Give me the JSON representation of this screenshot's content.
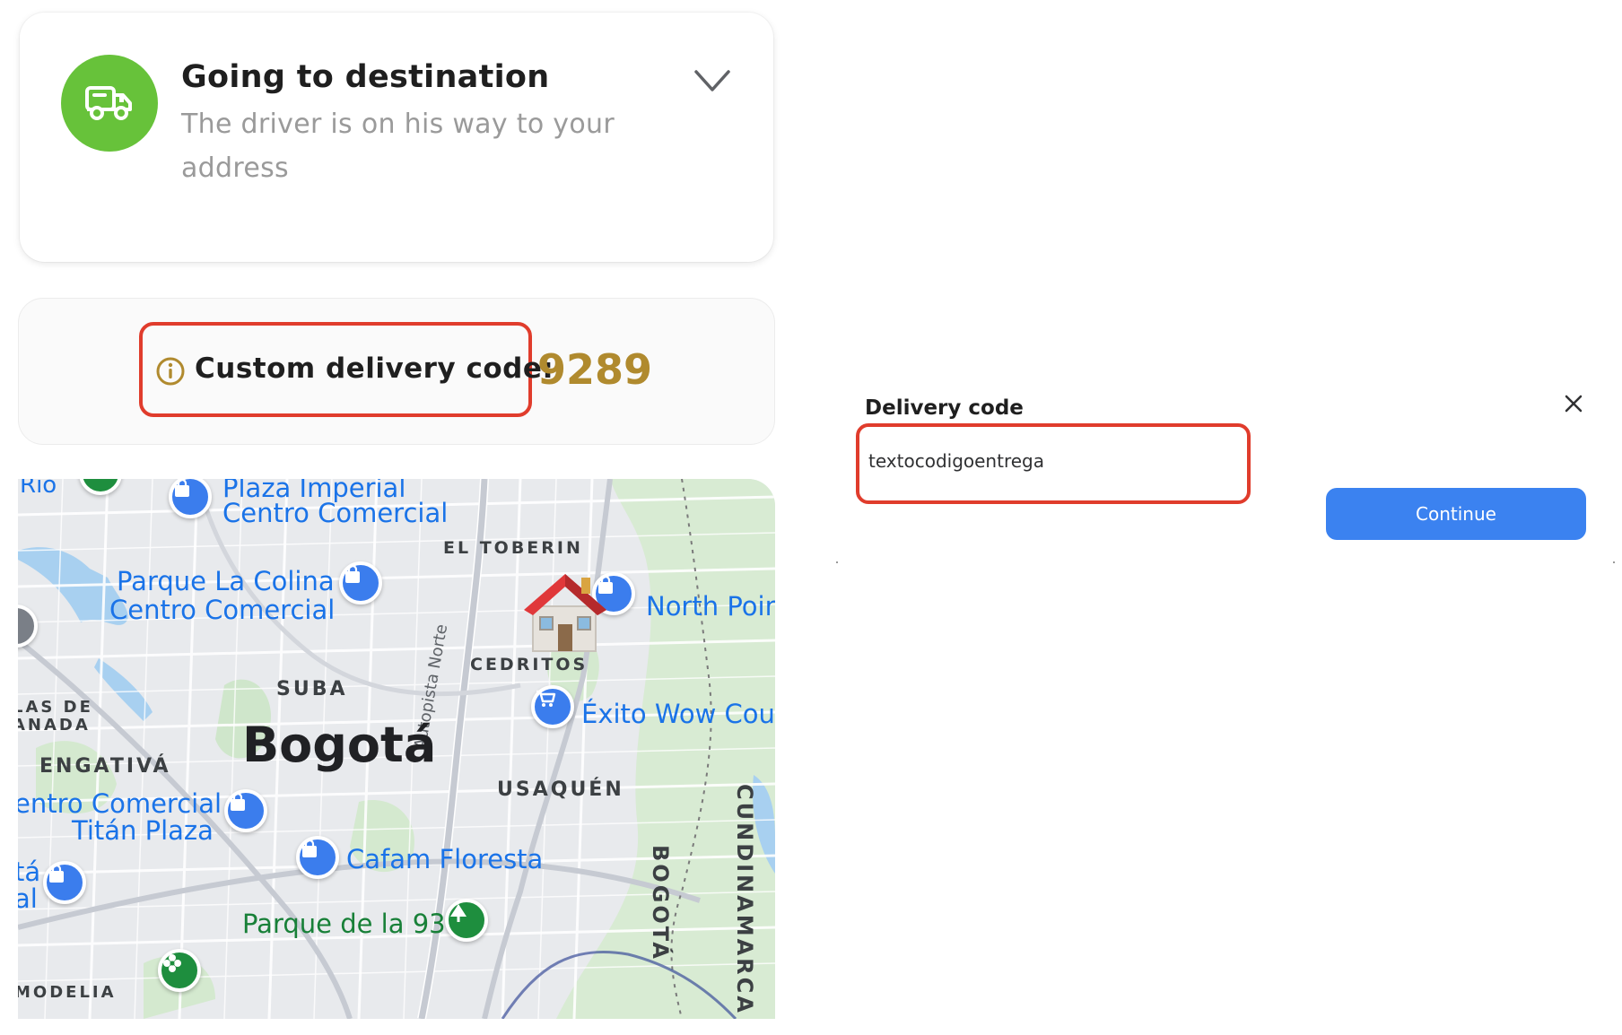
{
  "status_card": {
    "title": "Going to destination",
    "subtitle": "The driver is on his way to your address",
    "icon": "truck-icon",
    "icon_bg": "#67c23a",
    "expand_icon": "chevron-down-icon"
  },
  "delivery_code_card": {
    "info_icon": "info-circle-icon",
    "label": "Custom delivery code:",
    "value": "9289",
    "value_color": "#b08a2e",
    "highlight_color": "#e03c2c"
  },
  "map": {
    "labels": {
      "rio": "Río",
      "plaza_imperial_1": "Plaza Imperial",
      "plaza_imperial_2": "Centro Comercial",
      "el_toberin": "EL TOBERIN",
      "parque_colina_1": "Parque La Colina",
      "parque_colina_2": "Centro Comercial",
      "north_point": "North Poin",
      "cedritos": "CEDRITOS",
      "suba": "SUBA",
      "autopista": "Autopista Norte",
      "las_de": "LAS DE",
      "anada": "ANADA",
      "exito": "Éxito Wow Cour",
      "bogota": "Bogotá",
      "engativa": "ENGATIVÁ",
      "usaquen": "USAQUÉN",
      "titan_1": "entro Comercial",
      "titan_2": "Titán Plaza",
      "cundinamarca": "CUNDINAMARCA",
      "cafam": "Cafam Floresta",
      "bogota_vertical": "BOGOTÁ",
      "ta": "tá",
      "al": "al",
      "parque93": "Parque de la 93",
      "modelia": "MODELIA"
    }
  },
  "dialog": {
    "label": "Delivery code",
    "input_value": "textocodigoentrega",
    "continue_label": "Continue",
    "close_icon": "close-icon",
    "button_color": "#3b82f0"
  }
}
